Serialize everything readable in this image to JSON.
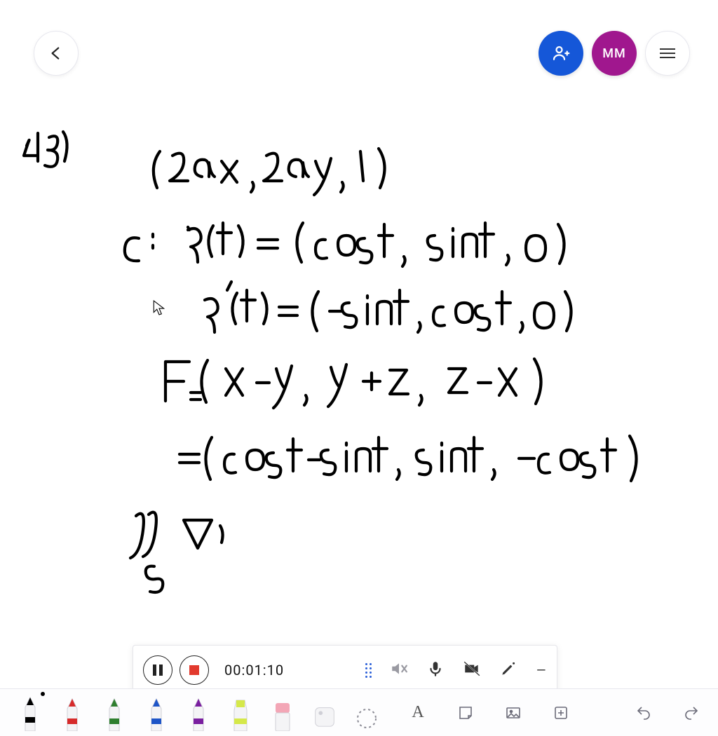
{
  "header": {
    "back_label": "Back",
    "add_person_label": "Add collaborator",
    "avatar_initials": "MM",
    "menu_label": "Menu"
  },
  "handwriting_lines": [
    "43)",
    "(2ax , 2ay , 1)",
    "C: γ(t) = (cos t, sin t, 0)",
    "γ'(t) = (−sin t, cos t, 0)",
    "F = (x − y, y + z, z − x)",
    "= (cos t − sin t, sin t, −cos t)",
    "∬_S ∇×"
  ],
  "recording": {
    "pause_label": "Pause",
    "stop_label": "Stop",
    "elapsed": "00:01:10",
    "mute_label": "Muted",
    "mic_label": "Microphone",
    "camera_off_label": "Camera off",
    "pointer_label": "Laser pointer",
    "minimize_label": "−"
  },
  "tools": {
    "pens": [
      {
        "color": "#000000",
        "selected": true
      },
      {
        "color": "#d62b2b",
        "selected": false
      },
      {
        "color": "#2f7f2f",
        "selected": false
      },
      {
        "color": "#1e55c7",
        "selected": false
      },
      {
        "color": "#7a1fa0",
        "selected": false
      }
    ],
    "highlighter_color": "#d5e84a",
    "text_label": "A",
    "eraser_label": "Eraser",
    "lasso_label": "Lasso",
    "shapes_label": "Shapes",
    "image_label": "Insert image",
    "add_label": "Add",
    "undo_label": "Undo",
    "redo_label": "Redo"
  }
}
